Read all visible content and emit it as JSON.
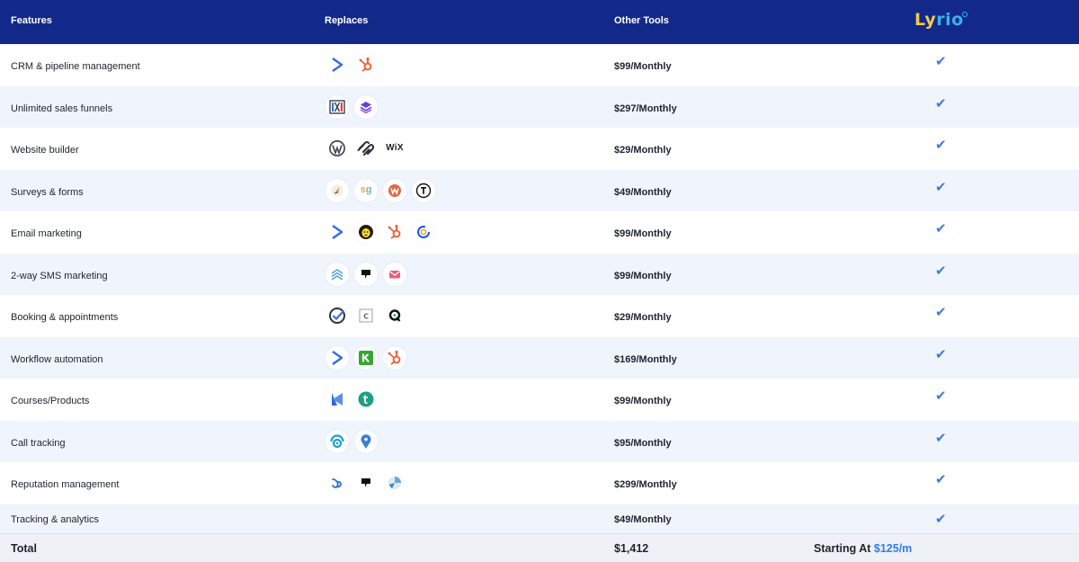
{
  "header": {
    "features": "Features",
    "replaces": "Replaces",
    "other_tools": "Other Tools",
    "brand": "Lyrio"
  },
  "rows": [
    {
      "feature": "CRM & pipeline management",
      "price": "$99/Monthly",
      "check": "✔",
      "icons": [
        "activecampaign-icon",
        "hubspot-icon"
      ]
    },
    {
      "feature": "Unlimited sales funnels",
      "price": "$297/Monthly",
      "check": "✔",
      "icons": [
        "clickfunnels-icon",
        "kartra-layers-icon"
      ]
    },
    {
      "feature": "Website builder",
      "price": "$29/Monthly",
      "check": "✔",
      "icons": [
        "wordpress-icon",
        "squarespace-icon",
        "wix-icon"
      ]
    },
    {
      "feature": "Surveys & forms",
      "price": "$49/Monthly",
      "check": "✔",
      "icons": [
        "typeform-bird-icon",
        "surveygizmo-icon",
        "wufoo-icon",
        "typeform-t-icon"
      ]
    },
    {
      "feature": "Email marketing",
      "price": "$99/Monthly",
      "check": "✔",
      "icons": [
        "activecampaign-icon",
        "mailchimp-icon",
        "hubspot-icon",
        "constantcontact-icon"
      ]
    },
    {
      "feature": "2-way SMS marketing",
      "price": "$99/Monthly",
      "check": "✔",
      "icons": [
        "textline-icon",
        "podium-icon",
        "simpletexting-icon"
      ]
    },
    {
      "feature": "Booking & appointments",
      "price": "$29/Monthly",
      "check": "✔",
      "icons": [
        "acuity-icon",
        "calendly-icon",
        "chili-piper-icon"
      ]
    },
    {
      "feature": "Workflow automation",
      "price": "$169/Monthly",
      "check": "✔",
      "icons": [
        "activecampaign-icon",
        "keap-icon",
        "hubspot-icon"
      ]
    },
    {
      "feature": "Courses/Products",
      "price": "$99/Monthly",
      "check": "✔",
      "icons": [
        "kajabi-icon",
        "teachable-icon"
      ]
    },
    {
      "feature": "Call tracking",
      "price": "$95/Monthly",
      "check": "✔",
      "icons": [
        "callrail-icon",
        "calltrackingmetrics-icon"
      ]
    },
    {
      "feature": "Reputation management",
      "price": "$299/Monthly",
      "check": "✔",
      "icons": [
        "birdeye-icon",
        "podium-icon",
        "grade-us-icon"
      ]
    },
    {
      "feature": "Tracking & analytics",
      "price": "$49/Monthly",
      "check": "✔",
      "icons": []
    }
  ],
  "total": {
    "label": "Total",
    "sum": "$1,412",
    "starting_label": "Starting At",
    "starting_price": "$125/m"
  },
  "colors": {
    "header_bg": "#13298a",
    "row_alt": "#f0f4fd",
    "check": "#3f7ae0",
    "accent_price": "#2f7ef0"
  }
}
